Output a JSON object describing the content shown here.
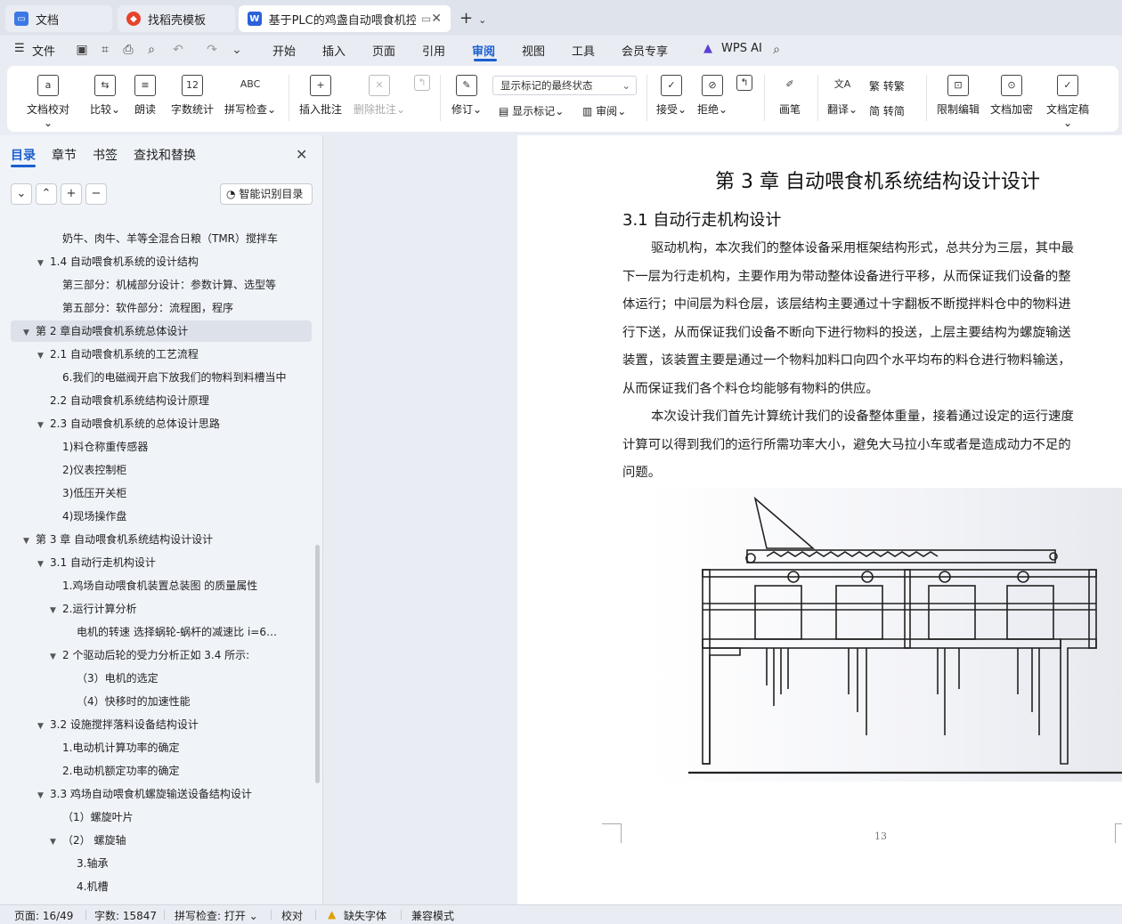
{
  "tabs": [
    {
      "label": "文档",
      "icon": "docs-icon"
    },
    {
      "label": "找稻壳模板",
      "icon": "docer-icon"
    },
    {
      "label": "基于PLC的鸡盏自动喂食机控制系统设计",
      "icon": "word-doc-icon"
    }
  ],
  "menu": {
    "file": "文件",
    "items": [
      "开始",
      "插入",
      "页面",
      "引用",
      "审阅",
      "视图",
      "工具",
      "会员专享"
    ],
    "active": "审阅",
    "wps_ai": "WPS AI"
  },
  "ribbon": {
    "doc_check": "文档校对",
    "compare": "比较",
    "read_aloud": "朗读",
    "word_count": "字数统计",
    "spell_check": "拼写检查",
    "insert_comment": "插入批注",
    "delete_comment": "删除批注",
    "revise": "修订",
    "markup_select": "显示标记的最终状态",
    "show_markup": "显示标记",
    "review": "审阅",
    "accept": "接受",
    "reject": "拒绝",
    "pen": "画笔",
    "translate": "翻译",
    "to_traditional": "转繁",
    "to_simplified": "转简",
    "restrict_edit": "限制编辑",
    "encrypt": "文档加密",
    "finalize": "文档定稿"
  },
  "panel": {
    "tabs": [
      "目录",
      "章节",
      "书签",
      "查找和替换"
    ],
    "smart_toc": "智能识别目录",
    "toc": [
      {
        "text": "奶牛、肉牛、羊等全混合日粮（TMR）搅拌车",
        "level": 2,
        "twisty": ""
      },
      {
        "text": "1.4  自动喂食机系统的设计结构",
        "level": 1,
        "twisty": "▼"
      },
      {
        "text": "第三部分：机械部分设计：参数计算、选型等",
        "level": 2,
        "twisty": ""
      },
      {
        "text": "第五部分：软件部分：流程图，程序",
        "level": 2,
        "twisty": ""
      },
      {
        "text": "第 2 章自动喂食机系统总体设计",
        "level": 0,
        "twisty": "▼",
        "selected": true
      },
      {
        "text": "2.1 自动喂食机系统的工艺流程",
        "level": 1,
        "twisty": "▼"
      },
      {
        "text": "6.我们的电磁阀开启下放我们的物料到料槽当中",
        "level": 2,
        "twisty": ""
      },
      {
        "text": "2.2 自动喂食机系统结构设计原理",
        "level": 1,
        "twisty": ""
      },
      {
        "text": "2.3 自动喂食机系统的总体设计思路",
        "level": 1,
        "twisty": "▼"
      },
      {
        "text": "1)料仓称重传感器",
        "level": 2,
        "twisty": ""
      },
      {
        "text": " 2)仪表控制柜",
        "level": 2,
        "twisty": ""
      },
      {
        "text": "3)低压开关柜",
        "level": 2,
        "twisty": ""
      },
      {
        "text": "4)现场操作盘",
        "level": 2,
        "twisty": ""
      },
      {
        "text": "第 3 章  自动喂食机系统结构设计设计",
        "level": 0,
        "twisty": "▼"
      },
      {
        "text": "3.1 自动行走机构设计",
        "level": 1,
        "twisty": "▼"
      },
      {
        "text": "1.鸡场自动喂食机装置总装图  的质量属性",
        "level": 2,
        "twisty": ""
      },
      {
        "text": "2.运行计算分析",
        "level": 2,
        "twisty": "▼"
      },
      {
        "text": "电机的转速        选择蜗轮-蜗杆的减速比 i=6…",
        "level": 3,
        "twisty": ""
      },
      {
        "text": "2 个驱动后轮的受力分析正如 3.4 所示:",
        "level": 2,
        "twisty": "▼"
      },
      {
        "text": "（3）电机的选定",
        "level": 3,
        "twisty": ""
      },
      {
        "text": "（4）快移时的加速性能",
        "level": 3,
        "twisty": ""
      },
      {
        "text": "3.2 设施搅拌落料设备结构设计",
        "level": 1,
        "twisty": "▼"
      },
      {
        "text": "1.电动机计算功率的确定",
        "level": 2,
        "twisty": ""
      },
      {
        "text": "2.电动机额定功率的确定",
        "level": 2,
        "twisty": ""
      },
      {
        "text": "3.3 鸡场自动喂食机螺旋输送设备结构设计",
        "level": 1,
        "twisty": "▼"
      },
      {
        "text": "（1）螺旋叶片",
        "level": 2,
        "twisty": ""
      },
      {
        "text": "（2）  螺旋轴",
        "level": 2,
        "twisty": "▼"
      },
      {
        "text": "3.轴承",
        "level": 3,
        "twisty": ""
      },
      {
        "text": "4.机槽",
        "level": 3,
        "twisty": ""
      }
    ]
  },
  "document": {
    "chapter_title": "第 3 章  自动喂食机系统结构设计设计",
    "section_title": "3.1 自动行走机构设计",
    "para1": [
      "驱动机构，本次我们的整体设备采用框架结构形式，总共分为三层，其中最",
      "下一层为行走机构，主要作用为带动整体设备进行平移，从而保证我们设备的整",
      "体运行；中间层为料仓层，该层结构主要通过十字翻板不断搅拌料仓中的物料进",
      "行下送，从而保证我们设备不断向下进行物料的投送，上层主要结构为螺旋输送",
      "装置，该装置主要是通过一个物料加料口向四个水平均布的料仓进行物料输送，",
      "从而保证我们各个料仓均能够有物料的供应。"
    ],
    "para2": [
      "本次设计我们首先计算统计我们的设备整体重量，接着通过设定的运行速度",
      "计算可以得到我们的运行所需功率大小，避免大马拉小车或者是造成动力不足的",
      "问题。"
    ],
    "page_number": "13"
  },
  "status": {
    "page": "页面: 16/49",
    "words": "字数: 15847",
    "spell": "拼写检查: 打开",
    "proof": "校对",
    "missing_font": "缺失字体",
    "compat": "兼容模式"
  },
  "colors": {
    "accent": "#1a5fd0",
    "page_bg": "#ffffff",
    "app_bg": "#e9edf3"
  }
}
